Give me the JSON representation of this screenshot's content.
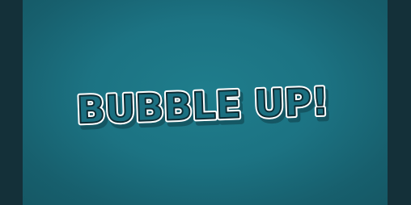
{
  "game": {
    "title": "BUBBLE UP!"
  },
  "colors": {
    "background_frame": "#143039",
    "canvas_center": "#1f7d8c",
    "canvas_edge": "#155865",
    "title_outline": "#ffffff",
    "title_fill": "#1b6f80",
    "title_stroke": "#0d2c34"
  }
}
